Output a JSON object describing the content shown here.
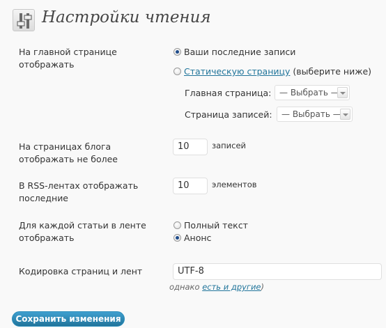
{
  "header": {
    "title": "Настройки чтения",
    "icon": "settings-sliders-icon"
  },
  "front_page": {
    "label": "На главной странице отображать",
    "option_latest": "Ваши последние записи",
    "option_static_link": "Статическую страницу",
    "option_static_suffix": " (выберите ниже)",
    "selected": "latest",
    "front_label": "Главная страница:",
    "front_value": "— Выбрать —",
    "posts_label": "Страница записей:",
    "posts_value": "— Выбрать —"
  },
  "blog_pages": {
    "label": "На страницах блога отображать не более",
    "value": "10",
    "unit": "записей"
  },
  "rss_items": {
    "label": "В RSS-лентах отображать последние",
    "value": "10",
    "unit": "элементов"
  },
  "rss_article": {
    "label": "Для каждой статьи в ленте отображать",
    "option_full": "Полный текст",
    "option_summary": "Анонс",
    "selected": "summary"
  },
  "encoding": {
    "label": "Кодировка страниц и лент",
    "value": "UTF-8",
    "note_prefix": "однако ",
    "note_link": "есть и другие",
    "note_suffix": ")"
  },
  "save_button": {
    "label": "Сохранить изменения"
  },
  "colors": {
    "accent": "#21759b",
    "button": "#2a8cbd",
    "background": "#f9f9f9"
  }
}
